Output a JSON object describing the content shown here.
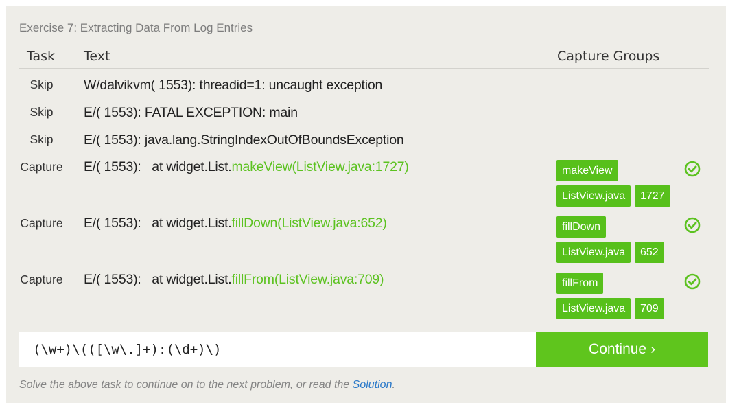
{
  "exercise_title": "Exercise 7: Extracting Data From Log Entries",
  "headers": {
    "task": "Task",
    "text": "Text",
    "groups": "Capture Groups"
  },
  "rows": [
    {
      "task": "Skip",
      "prefix": "W/dalvikvm( 1553): threadid=1: uncaught exception",
      "match": "",
      "suffix": "",
      "groups": []
    },
    {
      "task": "Skip",
      "prefix": "E/( 1553): FATAL EXCEPTION: main",
      "match": "",
      "suffix": "",
      "groups": []
    },
    {
      "task": "Skip",
      "prefix": "E/( 1553): java.lang.StringIndexOutOfBoundsException",
      "match": "",
      "suffix": "",
      "groups": []
    },
    {
      "task": "Capture",
      "prefix": "E/( 1553):   at widget.List.",
      "match": "makeView(ListView.java:1727)",
      "suffix": "",
      "groups": [
        "makeView",
        "ListView.java",
        "1727"
      ]
    },
    {
      "task": "Capture",
      "prefix": "E/( 1553):   at widget.List.",
      "match": "fillDown(ListView.java:652)",
      "suffix": "",
      "groups": [
        "fillDown",
        "ListView.java",
        "652"
      ]
    },
    {
      "task": "Capture",
      "prefix": "E/( 1553):   at widget.List.",
      "match": "fillFrom(ListView.java:709)",
      "suffix": "",
      "groups": [
        "fillFrom",
        "ListView.java",
        "709"
      ]
    }
  ],
  "regex_input": {
    "value": "(\\w+)\\(([\\w\\.]+):(\\d+)\\)"
  },
  "continue_label": "Continue ›",
  "footer": {
    "text": "Solve the above task to continue on to the next problem, or read the ",
    "link": "Solution",
    "end": "."
  },
  "colors": {
    "match": "#5cc220",
    "tag_bg": "#57c01b",
    "button_bg": "#5fc51d",
    "link": "#2a79c9"
  },
  "icons": {
    "row_status": "check-circle-icon"
  }
}
